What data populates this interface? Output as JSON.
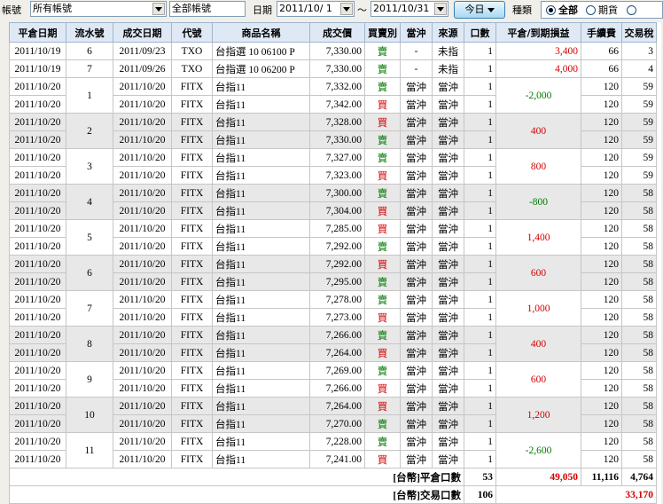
{
  "toolbar": {
    "account_label": "帳號",
    "account_value": "所有帳號",
    "account_name": "全部帳號",
    "date_label": "日期",
    "date_from": "2011/10/ 1",
    "date_sep": "～",
    "date_to": "2011/10/31",
    "today_button": "今日",
    "type_label": "種類",
    "radio_all": "全部",
    "radio_futures": "期貨"
  },
  "columns": [
    "平倉日期",
    "流水號",
    "成交日期",
    "代號",
    "商品名稱",
    "成交價",
    "買賣別",
    "當沖",
    "來源",
    "口數",
    "平倉/到期損益",
    "手續費",
    "交易稅"
  ],
  "groups": [
    {
      "serial": "6",
      "pnl": "3,400",
      "pnl_sign": "pos",
      "rows": [
        {
          "close": "2011/10/19",
          "trade": "2011/09/23",
          "code": "TXO",
          "name": "台指選 10 06100 P",
          "price": "7,330.00",
          "side": "賣",
          "daytrade": "-",
          "source": "未指",
          "qty": "1",
          "fee": "66",
          "tax": "3"
        }
      ]
    },
    {
      "serial": "7",
      "pnl": "4,000",
      "pnl_sign": "pos",
      "rows": [
        {
          "close": "2011/10/19",
          "trade": "2011/09/26",
          "code": "TXO",
          "name": "台指選 10 06200 P",
          "price": "7,330.00",
          "side": "賣",
          "daytrade": "-",
          "source": "未指",
          "qty": "1",
          "fee": "66",
          "tax": "4"
        }
      ]
    },
    {
      "serial": "1",
      "pnl": "-2,000",
      "pnl_sign": "neg",
      "rows": [
        {
          "close": "2011/10/20",
          "trade": "2011/10/20",
          "code": "FITX",
          "name": "台指11",
          "price": "7,332.00",
          "side": "賣",
          "daytrade": "當沖",
          "source": "當沖",
          "qty": "1",
          "fee": "120",
          "tax": "59"
        },
        {
          "close": "2011/10/20",
          "trade": "2011/10/20",
          "code": "FITX",
          "name": "台指11",
          "price": "7,342.00",
          "side": "買",
          "daytrade": "當沖",
          "source": "當沖",
          "qty": "1",
          "fee": "120",
          "tax": "59"
        }
      ]
    },
    {
      "serial": "2",
      "pnl": "400",
      "pnl_sign": "pos",
      "rows": [
        {
          "close": "2011/10/20",
          "trade": "2011/10/20",
          "code": "FITX",
          "name": "台指11",
          "price": "7,328.00",
          "side": "買",
          "daytrade": "當沖",
          "source": "當沖",
          "qty": "1",
          "fee": "120",
          "tax": "59"
        },
        {
          "close": "2011/10/20",
          "trade": "2011/10/20",
          "code": "FITX",
          "name": "台指11",
          "price": "7,330.00",
          "side": "賣",
          "daytrade": "當沖",
          "source": "當沖",
          "qty": "1",
          "fee": "120",
          "tax": "59"
        }
      ]
    },
    {
      "serial": "3",
      "pnl": "800",
      "pnl_sign": "pos",
      "rows": [
        {
          "close": "2011/10/20",
          "trade": "2011/10/20",
          "code": "FITX",
          "name": "台指11",
          "price": "7,327.00",
          "side": "賣",
          "daytrade": "當沖",
          "source": "當沖",
          "qty": "1",
          "fee": "120",
          "tax": "59"
        },
        {
          "close": "2011/10/20",
          "trade": "2011/10/20",
          "code": "FITX",
          "name": "台指11",
          "price": "7,323.00",
          "side": "買",
          "daytrade": "當沖",
          "source": "當沖",
          "qty": "1",
          "fee": "120",
          "tax": "59"
        }
      ]
    },
    {
      "serial": "4",
      "pnl": "-800",
      "pnl_sign": "neg",
      "rows": [
        {
          "close": "2011/10/20",
          "trade": "2011/10/20",
          "code": "FITX",
          "name": "台指11",
          "price": "7,300.00",
          "side": "賣",
          "daytrade": "當沖",
          "source": "當沖",
          "qty": "1",
          "fee": "120",
          "tax": "58"
        },
        {
          "close": "2011/10/20",
          "trade": "2011/10/20",
          "code": "FITX",
          "name": "台指11",
          "price": "7,304.00",
          "side": "買",
          "daytrade": "當沖",
          "source": "當沖",
          "qty": "1",
          "fee": "120",
          "tax": "58"
        }
      ]
    },
    {
      "serial": "5",
      "pnl": "1,400",
      "pnl_sign": "pos",
      "rows": [
        {
          "close": "2011/10/20",
          "trade": "2011/10/20",
          "code": "FITX",
          "name": "台指11",
          "price": "7,285.00",
          "side": "買",
          "daytrade": "當沖",
          "source": "當沖",
          "qty": "1",
          "fee": "120",
          "tax": "58"
        },
        {
          "close": "2011/10/20",
          "trade": "2011/10/20",
          "code": "FITX",
          "name": "台指11",
          "price": "7,292.00",
          "side": "賣",
          "daytrade": "當沖",
          "source": "當沖",
          "qty": "1",
          "fee": "120",
          "tax": "58"
        }
      ]
    },
    {
      "serial": "6",
      "pnl": "600",
      "pnl_sign": "pos",
      "rows": [
        {
          "close": "2011/10/20",
          "trade": "2011/10/20",
          "code": "FITX",
          "name": "台指11",
          "price": "7,292.00",
          "side": "買",
          "daytrade": "當沖",
          "source": "當沖",
          "qty": "1",
          "fee": "120",
          "tax": "58"
        },
        {
          "close": "2011/10/20",
          "trade": "2011/10/20",
          "code": "FITX",
          "name": "台指11",
          "price": "7,295.00",
          "side": "賣",
          "daytrade": "當沖",
          "source": "當沖",
          "qty": "1",
          "fee": "120",
          "tax": "58"
        }
      ]
    },
    {
      "serial": "7",
      "pnl": "1,000",
      "pnl_sign": "pos",
      "rows": [
        {
          "close": "2011/10/20",
          "trade": "2011/10/20",
          "code": "FITX",
          "name": "台指11",
          "price": "7,278.00",
          "side": "賣",
          "daytrade": "當沖",
          "source": "當沖",
          "qty": "1",
          "fee": "120",
          "tax": "58"
        },
        {
          "close": "2011/10/20",
          "trade": "2011/10/20",
          "code": "FITX",
          "name": "台指11",
          "price": "7,273.00",
          "side": "買",
          "daytrade": "當沖",
          "source": "當沖",
          "qty": "1",
          "fee": "120",
          "tax": "58"
        }
      ]
    },
    {
      "serial": "8",
      "pnl": "400",
      "pnl_sign": "pos",
      "rows": [
        {
          "close": "2011/10/20",
          "trade": "2011/10/20",
          "code": "FITX",
          "name": "台指11",
          "price": "7,266.00",
          "side": "賣",
          "daytrade": "當沖",
          "source": "當沖",
          "qty": "1",
          "fee": "120",
          "tax": "58"
        },
        {
          "close": "2011/10/20",
          "trade": "2011/10/20",
          "code": "FITX",
          "name": "台指11",
          "price": "7,264.00",
          "side": "買",
          "daytrade": "當沖",
          "source": "當沖",
          "qty": "1",
          "fee": "120",
          "tax": "58"
        }
      ]
    },
    {
      "serial": "9",
      "pnl": "600",
      "pnl_sign": "pos",
      "rows": [
        {
          "close": "2011/10/20",
          "trade": "2011/10/20",
          "code": "FITX",
          "name": "台指11",
          "price": "7,269.00",
          "side": "賣",
          "daytrade": "當沖",
          "source": "當沖",
          "qty": "1",
          "fee": "120",
          "tax": "58"
        },
        {
          "close": "2011/10/20",
          "trade": "2011/10/20",
          "code": "FITX",
          "name": "台指11",
          "price": "7,266.00",
          "side": "買",
          "daytrade": "當沖",
          "source": "當沖",
          "qty": "1",
          "fee": "120",
          "tax": "58"
        }
      ]
    },
    {
      "serial": "10",
      "pnl": "1,200",
      "pnl_sign": "pos",
      "rows": [
        {
          "close": "2011/10/20",
          "trade": "2011/10/20",
          "code": "FITX",
          "name": "台指11",
          "price": "7,264.00",
          "side": "買",
          "daytrade": "當沖",
          "source": "當沖",
          "qty": "1",
          "fee": "120",
          "tax": "58"
        },
        {
          "close": "2011/10/20",
          "trade": "2011/10/20",
          "code": "FITX",
          "name": "台指11",
          "price": "7,270.00",
          "side": "賣",
          "daytrade": "當沖",
          "source": "當沖",
          "qty": "1",
          "fee": "120",
          "tax": "58"
        }
      ]
    },
    {
      "serial": "11",
      "pnl": "-2,600",
      "pnl_sign": "neg",
      "rows": [
        {
          "close": "2011/10/20",
          "trade": "2011/10/20",
          "code": "FITX",
          "name": "台指11",
          "price": "7,228.00",
          "side": "賣",
          "daytrade": "當沖",
          "source": "當沖",
          "qty": "1",
          "fee": "120",
          "tax": "58"
        },
        {
          "close": "2011/10/20",
          "trade": "2011/10/20",
          "code": "FITX",
          "name": "台指11",
          "price": "7,241.00",
          "side": "買",
          "daytrade": "當沖",
          "source": "當沖",
          "qty": "1",
          "fee": "120",
          "tax": "58"
        }
      ]
    }
  ],
  "summary": {
    "close_label": "[台幣]平倉口數",
    "close_qty": "53",
    "close_pnl": "49,050",
    "close_fee": "11,116",
    "close_tax": "4,764",
    "trade_label": "[台幣]交易口數",
    "trade_qty": "106",
    "trade_total": "33,170"
  },
  "colors": {
    "sell": "#007a00",
    "buy": "#d40000"
  }
}
